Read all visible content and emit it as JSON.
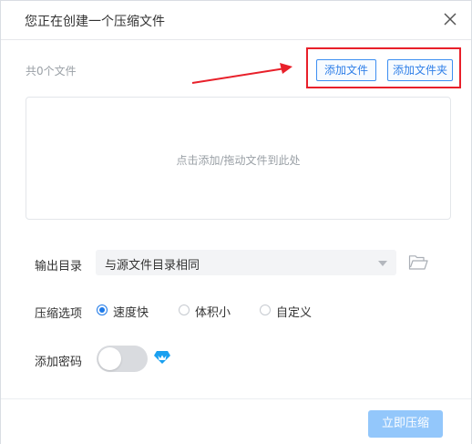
{
  "dialog": {
    "title": "您正在创建一个压缩文件",
    "close_icon": "close-icon"
  },
  "files": {
    "count_label": "共0个文件",
    "add_file_label": "添加文件",
    "add_folder_label": "添加文件夹",
    "drop_hint": "点击添加/拖动文件到此处"
  },
  "output": {
    "label": "输出目录",
    "selected": "与源文件目录相同",
    "folder_icon": "folder-open-icon"
  },
  "compress_options": {
    "label": "压缩选项",
    "options": [
      {
        "label": "速度快",
        "checked": true
      },
      {
        "label": "体积小",
        "checked": false
      },
      {
        "label": "自定义",
        "checked": false
      }
    ]
  },
  "password": {
    "label": "添加密码",
    "enabled": false,
    "vip_icon": "vip-crown-icon"
  },
  "footer": {
    "compress_button": "立即压缩"
  },
  "colors": {
    "accent": "#1f7ae8",
    "highlight": "#e8202a",
    "primary_disabled": "#93c7fb"
  }
}
